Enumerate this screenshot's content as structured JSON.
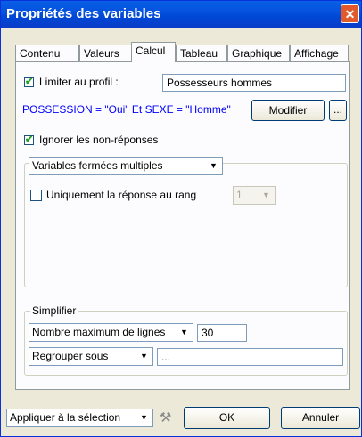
{
  "window": {
    "title": "Propriétés des variables",
    "close_icon": "close-icon"
  },
  "tabs": [
    {
      "label": "Contenu"
    },
    {
      "label": "Valeurs"
    },
    {
      "label": "Calcul"
    },
    {
      "label": "Tableau"
    },
    {
      "label": "Graphique"
    },
    {
      "label": "Affichage"
    }
  ],
  "profile": {
    "checkbox_label": "Limiter au profil :",
    "checked": true,
    "name_value": "Possesseurs hommes",
    "condition_text": "POSSESSION = \"Oui\" Et SEXE = \"Homme\"",
    "modify_label": "Modifier",
    "more_label": "..."
  },
  "ignore_nonresponse": {
    "label": "Ignorer les non-réponses",
    "checked": true
  },
  "variables_group": {
    "selected": "Variables fermées multiples",
    "rank_checkbox_label": "Uniquement la réponse au rang",
    "rank_checked": false,
    "rank_value": "1"
  },
  "simplify": {
    "caption": "Simplifier",
    "max_lines_option": "Nombre maximum de lignes",
    "max_lines_value": "30",
    "group_option": "Regrouper sous",
    "group_value": "..."
  },
  "footer": {
    "apply_option": "Appliquer à la sélection",
    "ok_label": "OK",
    "cancel_label": "Annuler"
  }
}
